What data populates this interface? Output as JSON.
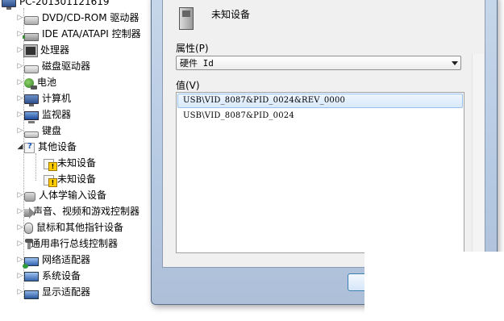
{
  "tree": {
    "root_label": "PC-201301121619",
    "items": [
      {
        "label": "DVD/CD-ROM 驱动器",
        "icon": "dvd-drive-icon"
      },
      {
        "label": "IDE ATA/ATAPI 控制器",
        "icon": "ide-controller-icon"
      },
      {
        "label": "处理器",
        "icon": "processor-icon"
      },
      {
        "label": "磁盘驱动器",
        "icon": "disk-drive-icon"
      },
      {
        "label": "电池",
        "icon": "battery-icon"
      },
      {
        "label": "计算机",
        "icon": "computer-icon"
      },
      {
        "label": "监视器",
        "icon": "monitor-icon"
      },
      {
        "label": "键盘",
        "icon": "keyboard-icon"
      },
      {
        "label": "其他设备",
        "icon": "other-devices-icon"
      },
      {
        "label": "未知设备",
        "icon": "unknown-device-warning-icon"
      },
      {
        "label": "未知设备",
        "icon": "unknown-device-warning-icon"
      },
      {
        "label": "人体学输入设备",
        "icon": "hid-icon"
      },
      {
        "label": "声音、视频和游戏控制器",
        "icon": "sound-icon"
      },
      {
        "label": "鼠标和其他指针设备",
        "icon": "mouse-icon"
      },
      {
        "label": "通用串行总线控制器",
        "icon": "usb-icon"
      },
      {
        "label": "网络适配器",
        "icon": "network-adapter-icon"
      },
      {
        "label": "系统设备",
        "icon": "system-device-icon"
      },
      {
        "label": "显示适配器",
        "icon": "display-adapter-icon"
      }
    ]
  },
  "dialog": {
    "device_name": "未知设备",
    "property_label": "属性(P)",
    "property_value": "硬件 Id",
    "value_label": "值(V)",
    "values": [
      "USB\\VID_8087&PID_0024&REV_0000",
      "USB\\VID_8087&PID_0024"
    ]
  }
}
